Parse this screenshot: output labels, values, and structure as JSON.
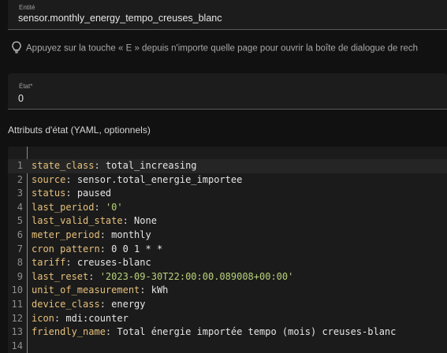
{
  "entity": {
    "label": "Entité",
    "value": "sensor.monthly_energy_tempo_creuses_blanc"
  },
  "hint": {
    "icon": "lightbulb-icon",
    "text": "Appuyez sur la touche « E » depuis n'importe quelle page pour ouvrir la boîte de dialogue de rech"
  },
  "state": {
    "label": "État*",
    "value": "0"
  },
  "attributes": {
    "title": "Attributs d'état (YAML, optionnels)",
    "lines": [
      {
        "n": "1",
        "key": "state_class",
        "sep": ": ",
        "val": "total_increasing",
        "type": "v"
      },
      {
        "n": "2",
        "key": "source",
        "sep": ": ",
        "val": "sensor.total_energie_importee",
        "type": "v"
      },
      {
        "n": "3",
        "key": "status",
        "sep": ": ",
        "val": "paused",
        "type": "v"
      },
      {
        "n": "4",
        "key": "last_period",
        "sep": ": ",
        "val": "'0'",
        "type": "s"
      },
      {
        "n": "5",
        "key": "last_valid_state",
        "sep": ": ",
        "val": "None",
        "type": "v"
      },
      {
        "n": "6",
        "key": "meter_period",
        "sep": ": ",
        "val": "monthly",
        "type": "v"
      },
      {
        "n": "7",
        "key": "cron pattern",
        "sep": ": ",
        "val": "0 0 1 * *",
        "type": "v"
      },
      {
        "n": "8",
        "key": "tariff",
        "sep": ": ",
        "val": "creuses-blanc",
        "type": "v"
      },
      {
        "n": "9",
        "key": "last_reset",
        "sep": ": ",
        "val": "'2023-09-30T22:00:00.089008+00:00'",
        "type": "s"
      },
      {
        "n": "10",
        "key": "unit_of_measurement",
        "sep": ": ",
        "val": "kWh",
        "type": "v"
      },
      {
        "n": "11",
        "key": "device_class",
        "sep": ": ",
        "val": "energy",
        "type": "v"
      },
      {
        "n": "12",
        "key": "icon",
        "sep": ": ",
        "val": "mdi:counter",
        "type": "v"
      },
      {
        "n": "13",
        "key": "friendly_name",
        "sep": ": ",
        "val": "Total énergie importée tempo (mois) creuses-blanc",
        "type": "v"
      },
      {
        "n": "14",
        "key": "",
        "sep": "",
        "val": "",
        "type": "v"
      }
    ]
  },
  "colors": {
    "background": "#111111",
    "yaml_key": "#e6c07b",
    "yaml_string": "#b9d27a"
  }
}
